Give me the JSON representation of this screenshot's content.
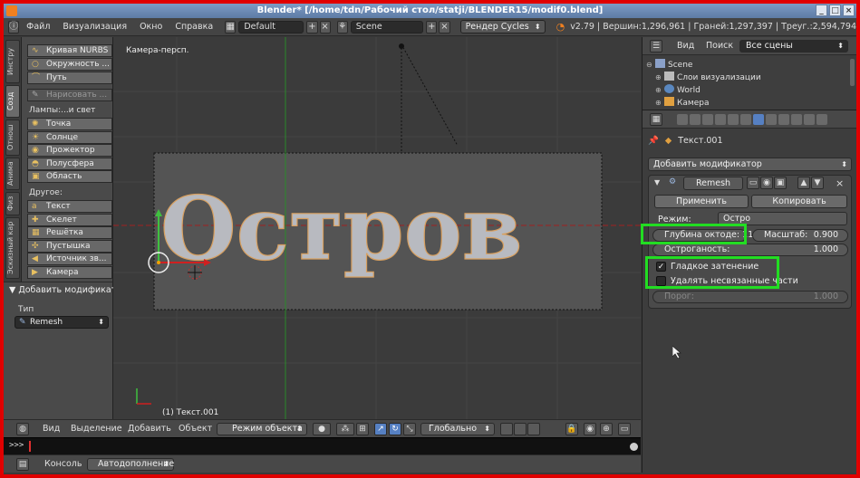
{
  "window": {
    "title": "Blender* [/home/tdn/Рабочий стол/statji/BLENDER15/modif0.blend]"
  },
  "menubar": {
    "items": [
      "Файл",
      "Визуализация",
      "Окно",
      "Справка"
    ],
    "layout": "Default",
    "scene": "Scene",
    "render_engine": "Рендер Cycles",
    "stats": "v2.79 | Вершин:1,296,961 | Граней:1,297,397 | Треуг.:2,594,794"
  },
  "toolshelf": {
    "tabs": [
      "Инстру",
      "Созд",
      "Отнош",
      "Анима",
      "Физ",
      "Эскизный кар"
    ],
    "top_buttons": [
      "Кривая NURBS",
      "Окружность ...",
      "Путь"
    ],
    "draw_button": "Нарисовать ...",
    "lamps_label": "Лампы:...и свет",
    "lamps": [
      "Точка",
      "Солнце",
      "Прожектор",
      "Полусфера",
      "Область"
    ],
    "other_label": "Другое:",
    "other": [
      "Текст",
      "Скелет",
      "Решётка",
      "Пустышка",
      "Источник зв...",
      "Камера"
    ]
  },
  "operator_panel": {
    "title": "▼ Добавить модификат",
    "type_label": "Тип",
    "type_value": "Remesh"
  },
  "viewport": {
    "view_label": "Камера-персп.",
    "object_label": "(1) Текст.001",
    "text_object": "Остров"
  },
  "viewport_header": {
    "menus": [
      "Вид",
      "Выделение",
      "Добавить",
      "Объект"
    ],
    "mode": "Режим объекта",
    "orientation": "Глобально"
  },
  "console": {
    "prompt": ">>>",
    "tabs": [
      "Консоль",
      "Автодополнение"
    ]
  },
  "outliner": {
    "menus": [
      "Вид",
      "Поиск"
    ],
    "scope": "Все сцены",
    "rows": [
      "Scene",
      "Слои визуализации",
      "World",
      "Камера"
    ]
  },
  "properties": {
    "breadcrumb": "Текст.001",
    "add_modifier": "Добавить модификатор",
    "modifier": {
      "name": "Remesh",
      "apply": "Применить",
      "copy": "Копировать",
      "mode_label": "Режим:",
      "mode_value": "Остро",
      "octree_depth": "Глубина октоде: 11",
      "scale_label": "Масштаб:",
      "scale_value": "0.900",
      "sharpness_label": "Остроганость:",
      "sharpness_value": "1.000",
      "smooth_shading": "Гладкое затенение",
      "remove_disconnected": "Удалять несвязанные части",
      "threshold_label": "Порог:",
      "threshold_value": "1.000",
      "smooth_checked": true,
      "remove_checked": false
    }
  },
  "colors": {
    "highlight": "#22dd22",
    "frame": "#e00000",
    "accent": "#5680c2"
  }
}
